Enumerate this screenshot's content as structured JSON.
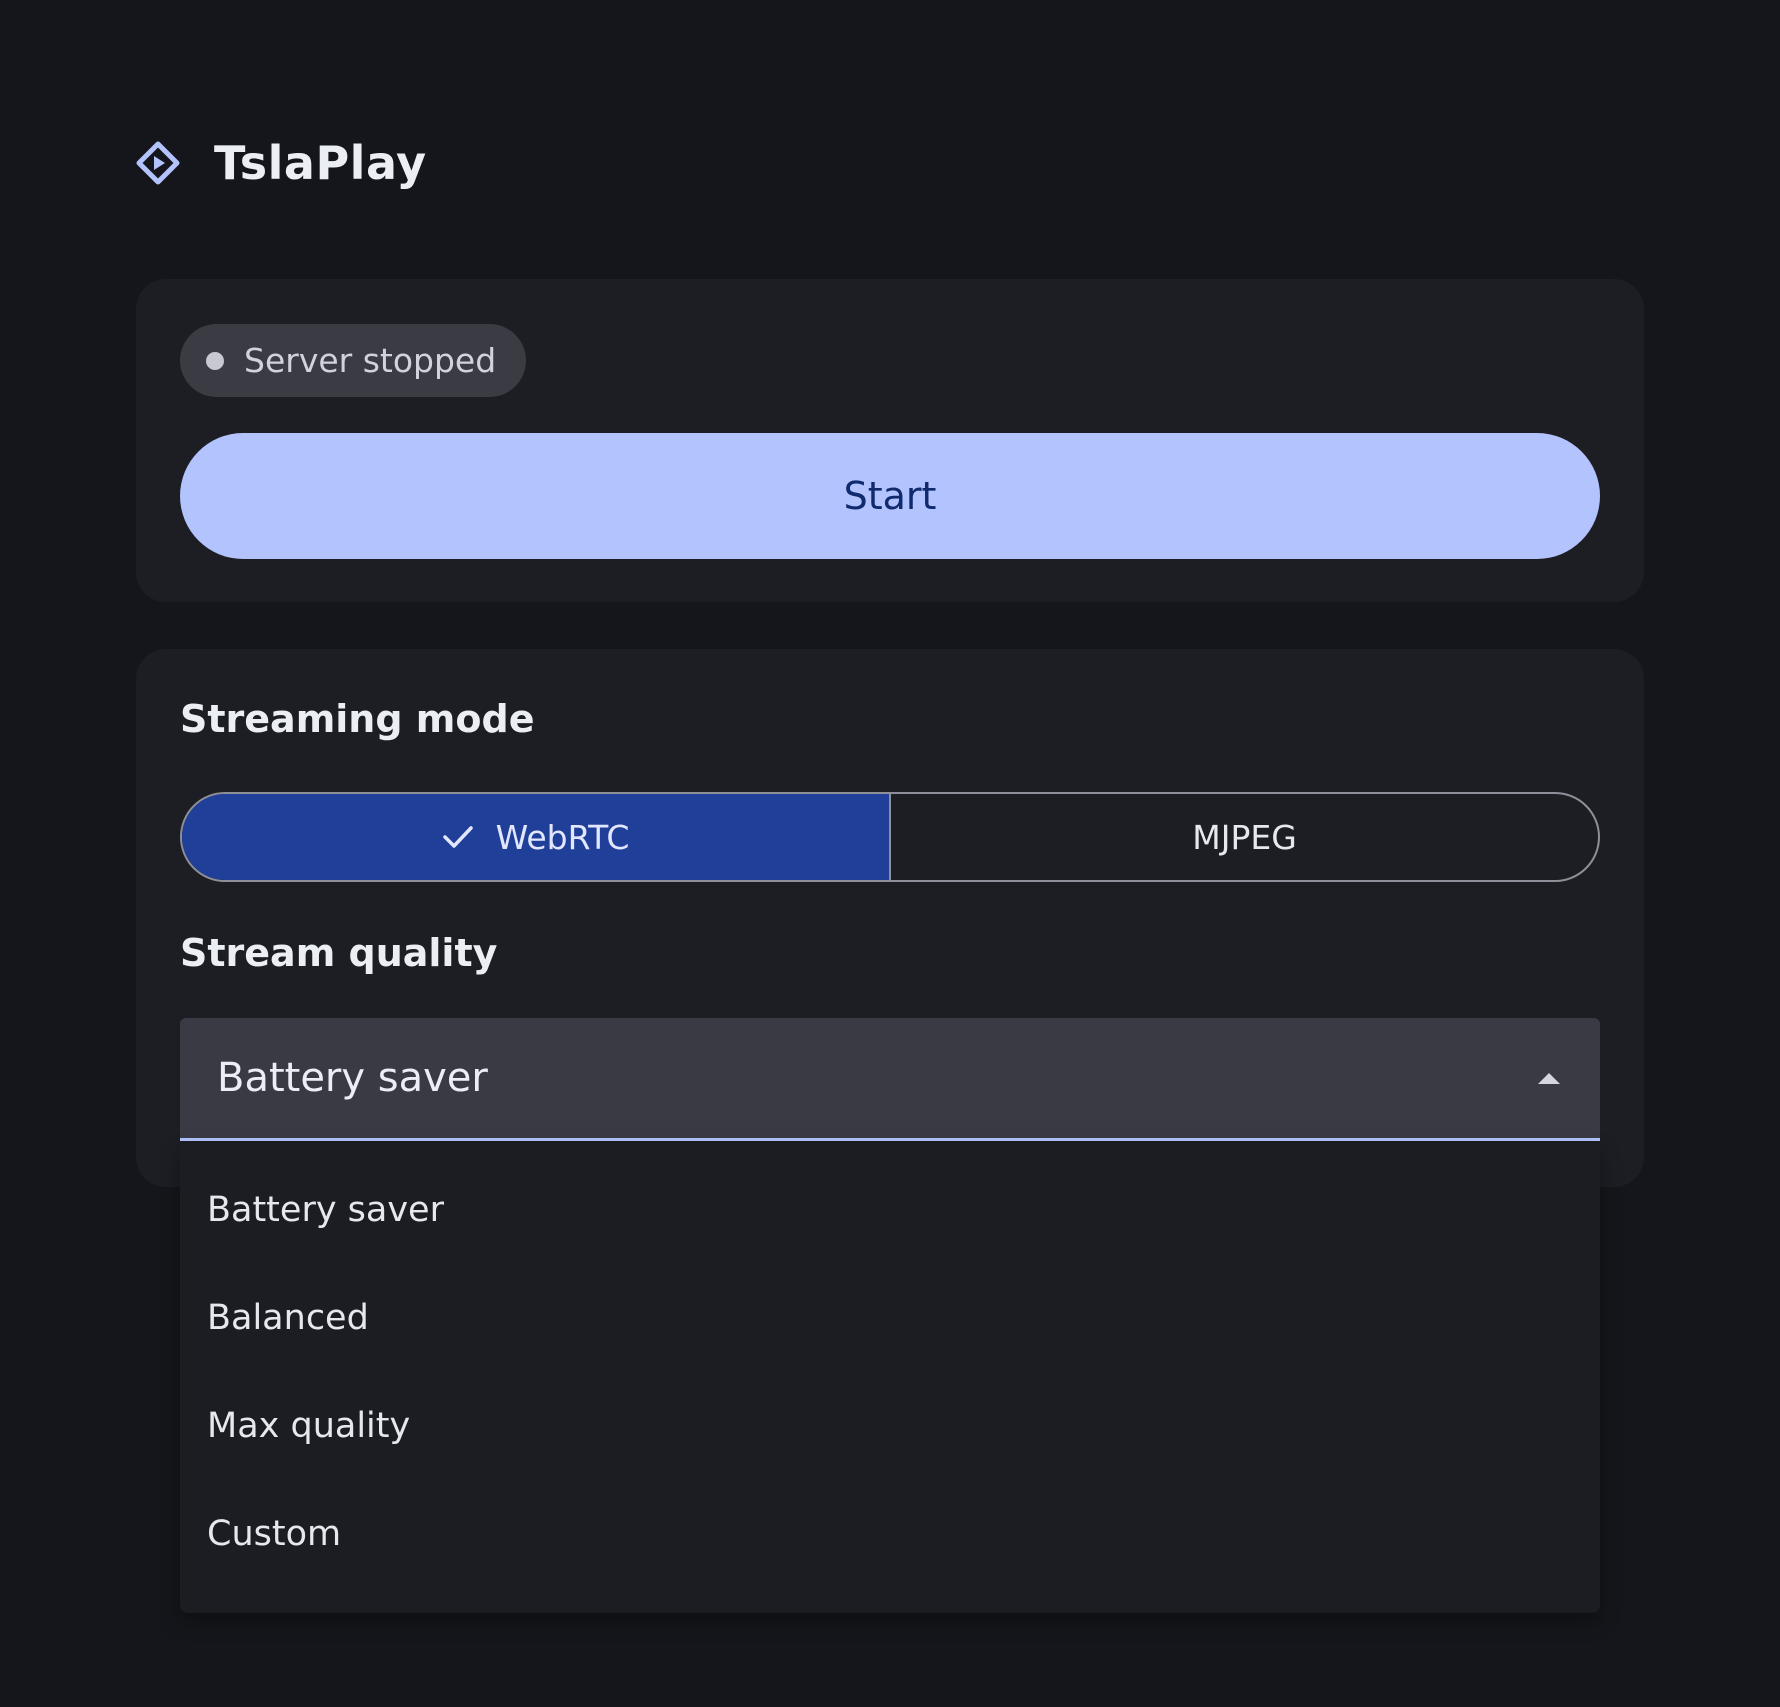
{
  "app": {
    "title": "TslaPlay",
    "logo_icon": "play-diamond-icon",
    "accent_color": "#b3c3fd"
  },
  "server": {
    "status_text": "Server stopped",
    "status_color": "#c7c8d0",
    "start_label": "Start"
  },
  "streaming": {
    "mode_label": "Streaming mode",
    "modes": [
      {
        "label": "WebRTC",
        "selected": true
      },
      {
        "label": "MJPEG",
        "selected": false
      }
    ],
    "selected_color": "#1f3f98"
  },
  "quality": {
    "label": "Stream quality",
    "selected": "Battery saver",
    "expanded": true,
    "options": [
      "Battery saver",
      "Balanced",
      "Max quality",
      "Custom"
    ]
  }
}
